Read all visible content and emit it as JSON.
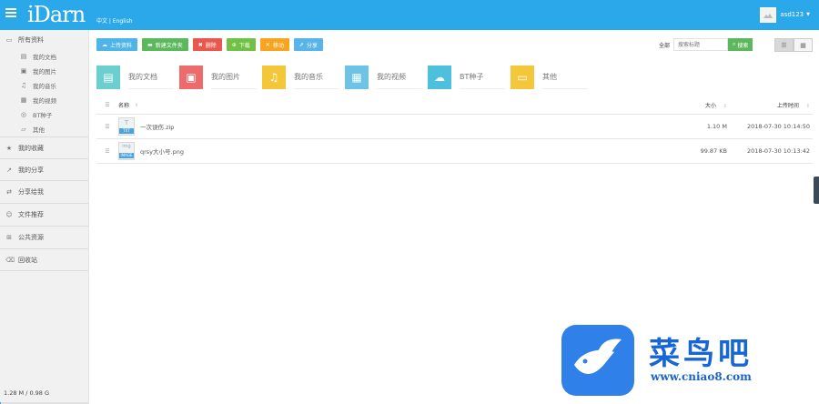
{
  "topbar": {
    "logo": "iDarn",
    "languages": "中文 | English",
    "username": "asd123",
    "accent": "#2aa8ea"
  },
  "sidebar": {
    "root": {
      "label": "所有资料",
      "icon": "folder-icon"
    },
    "items": [
      {
        "label": "我的文档",
        "icon": "document-icon"
      },
      {
        "label": "我的图片",
        "icon": "image-icon"
      },
      {
        "label": "我的音乐",
        "icon": "music-icon"
      },
      {
        "label": "我的视频",
        "icon": "video-icon"
      },
      {
        "label": "BT种子",
        "icon": "torrent-icon"
      },
      {
        "label": "其他",
        "icon": "other-icon"
      }
    ],
    "sections": [
      {
        "label": "我的收藏",
        "icon": "star-icon"
      },
      {
        "label": "我的分享",
        "icon": "share-icon"
      },
      {
        "label": "分享给我",
        "icon": "shared-with-me-icon"
      },
      {
        "label": "文件推荐",
        "icon": "recommend-icon"
      },
      {
        "label": "公共资源",
        "icon": "public-icon"
      },
      {
        "label": "回收站",
        "icon": "trash-icon"
      }
    ],
    "storage": {
      "text": "1.28 M / 0.98 G",
      "used_fraction": 0.0013
    }
  },
  "toolbar": {
    "upload": "上传资料",
    "new_folder": "新建文件夹",
    "delete": "删除",
    "download": "下载",
    "move": "移动",
    "share": "分享"
  },
  "search": {
    "scope": "全部",
    "placeholder": "搜索标题",
    "button": "搜索"
  },
  "categories": [
    {
      "label": "我的文档",
      "icon": "document-icon",
      "color": "#6ccfcf"
    },
    {
      "label": "我的图片",
      "icon": "image-icon",
      "color": "#ef6b6b"
    },
    {
      "label": "我的音乐",
      "icon": "music-icon",
      "color": "#f4c63a"
    },
    {
      "label": "我的视频",
      "icon": "film-icon",
      "color": "#6cc3e6"
    },
    {
      "label": "BT种子",
      "icon": "cloud-download-icon",
      "color": "#4cc0dc"
    },
    {
      "label": "其他",
      "icon": "folder-open-icon",
      "color": "#f4c63a"
    }
  ],
  "table": {
    "headers": {
      "name": "名称",
      "size": "大小",
      "time": "上传时间"
    },
    "rows": [
      {
        "name": "一次误伤.zip",
        "size": "1.10 M",
        "time": "2018-07-30 10:14:50",
        "type_tag": "TXT",
        "glyph": "T"
      },
      {
        "name": "qrsy大小号.png",
        "size": "99.87 KB",
        "time": "2018-07-30 10:13:42",
        "type_tag": "IMAGE",
        "glyph": "img"
      }
    ]
  },
  "watermark": {
    "text": "菜鸟吧",
    "url": "www.cniao8.com"
  }
}
